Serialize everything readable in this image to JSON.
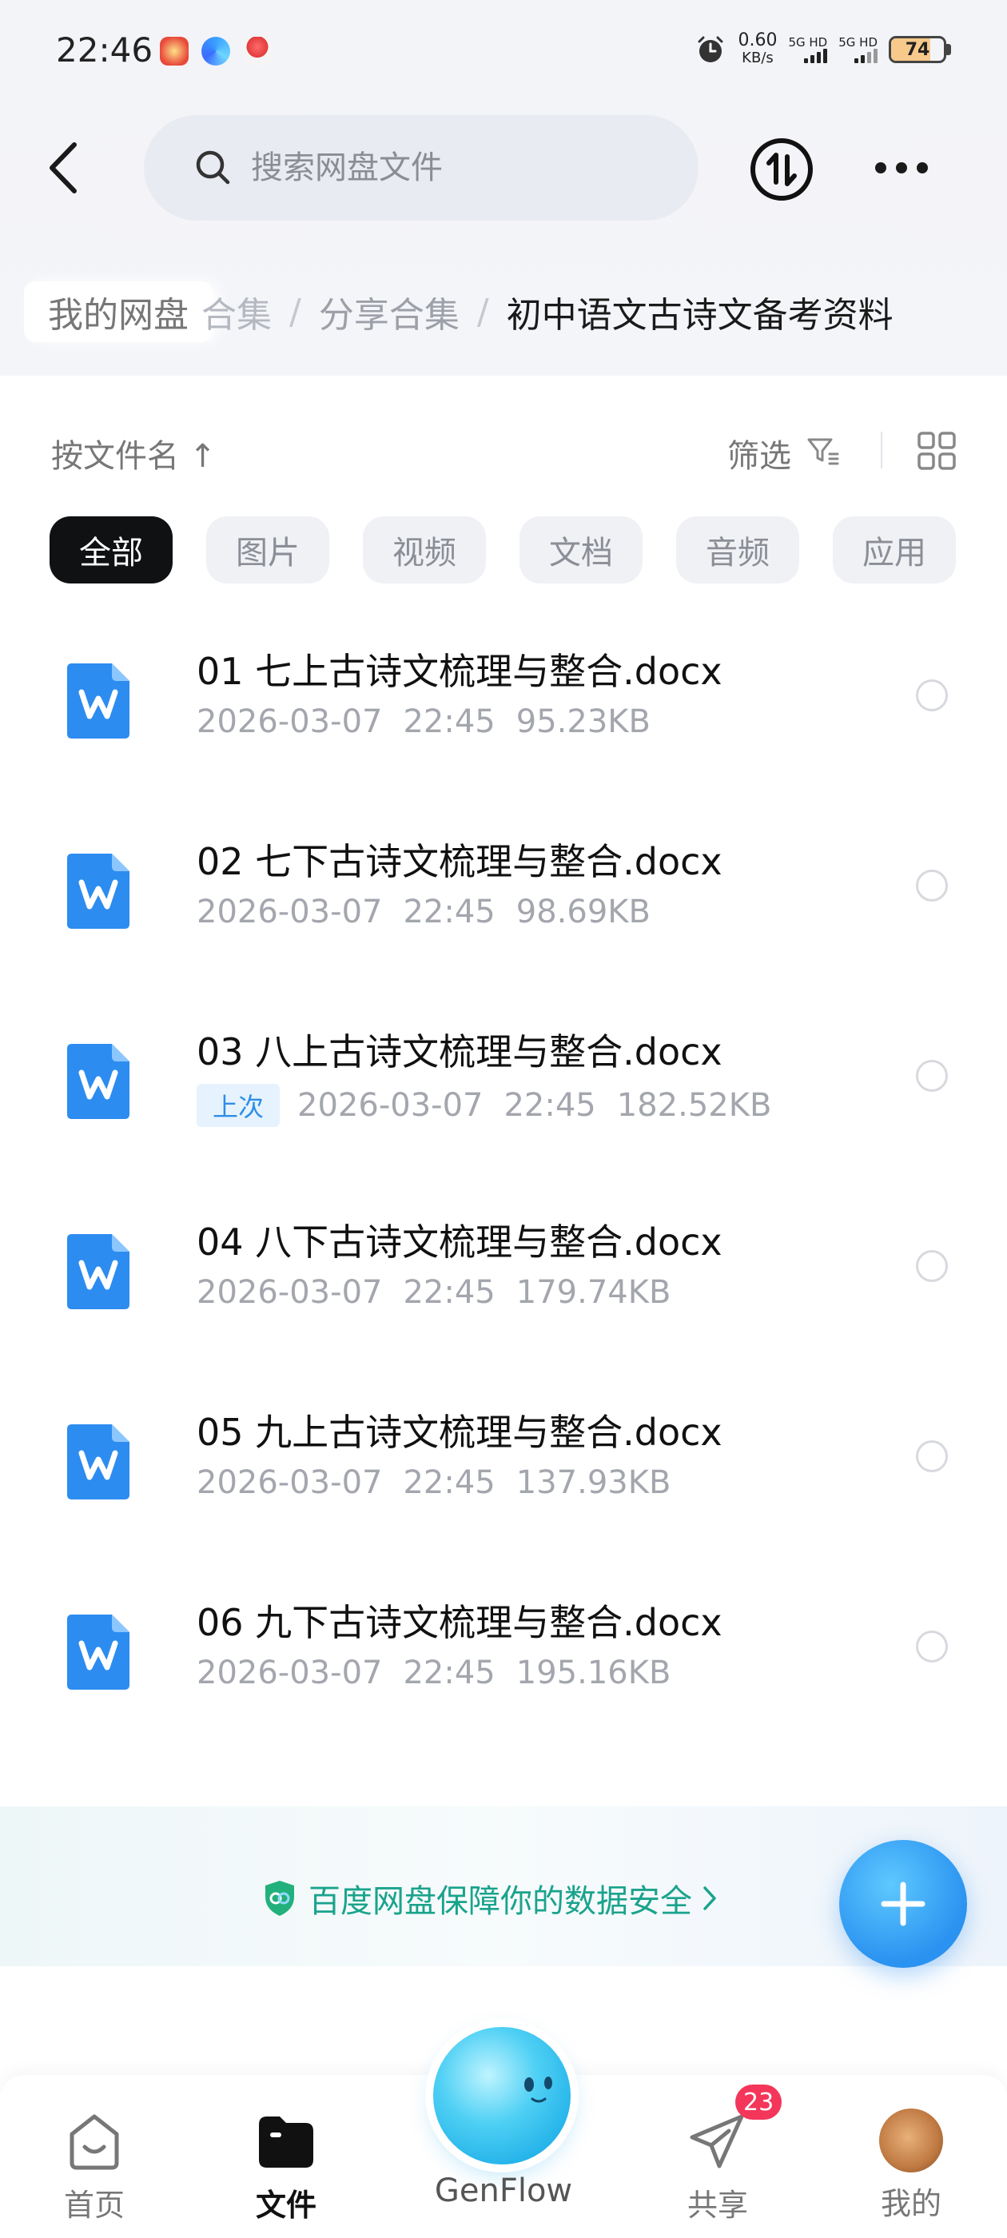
{
  "status": {
    "time": "22:46",
    "net_speed_value": "0.60",
    "net_speed_unit": "KB/s",
    "signal1_label": "5G HD",
    "signal2_label": "5G HD",
    "battery": "74",
    "battery_level": 0.74,
    "app_icons": [
      "clown-app-icon",
      "baidu-netdisk-app-icon",
      "location-app-icon"
    ]
  },
  "search": {
    "placeholder": "搜索网盘文件"
  },
  "breadcrumb": {
    "root": "我的网盘",
    "faded_fragment": "合集",
    "middle": "分享合集",
    "current": "初中语文古诗文备考资料",
    "separator": "/"
  },
  "toolbar": {
    "sort_label": "按文件名 ↑",
    "filter_label": "筛选"
  },
  "filter_chips": [
    {
      "label": "全部",
      "active": true
    },
    {
      "label": "图片",
      "active": false
    },
    {
      "label": "视频",
      "active": false
    },
    {
      "label": "文档",
      "active": false
    },
    {
      "label": "音频",
      "active": false
    },
    {
      "label": "应用",
      "active": false
    }
  ],
  "files": [
    {
      "name": "01 七上古诗文梳理与整合.docx",
      "date": "2026-03-07",
      "time": "22:45",
      "size": "95.23KB",
      "badge": ""
    },
    {
      "name": "02 七下古诗文梳理与整合.docx",
      "date": "2026-03-07",
      "time": "22:45",
      "size": "98.69KB",
      "badge": ""
    },
    {
      "name": "03 八上古诗文梳理与整合.docx",
      "date": "2026-03-07",
      "time": "22:45",
      "size": "182.52KB",
      "badge": "上次"
    },
    {
      "name": "04 八下古诗文梳理与整合.docx",
      "date": "2026-03-07",
      "time": "22:45",
      "size": "179.74KB",
      "badge": ""
    },
    {
      "name": "05 九上古诗文梳理与整合.docx",
      "date": "2026-03-07",
      "time": "22:45",
      "size": "137.93KB",
      "badge": ""
    },
    {
      "name": "06 九下古诗文梳理与整合.docx",
      "date": "2026-03-07",
      "time": "22:45",
      "size": "195.16KB",
      "badge": ""
    }
  ],
  "security_banner": {
    "text": "百度网盘保障你的数据安全",
    "color": "#1aa38c"
  },
  "bottom_nav": {
    "home": "首页",
    "files": "文件",
    "genflow": "GenFlow",
    "share": "共享",
    "share_badge": "23",
    "mine": "我的"
  },
  "colors": {
    "accent": "#2a92f0",
    "active_chip": "#0f1113",
    "badge": "#f3365a",
    "doc_icon": "#2d8cf0"
  }
}
